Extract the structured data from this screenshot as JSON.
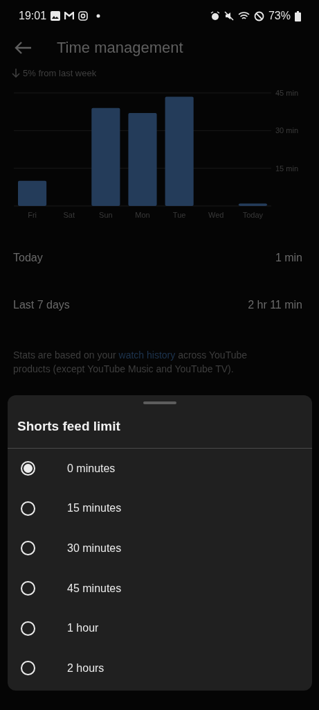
{
  "status_bar": {
    "time": "19:01",
    "battery": "73%"
  },
  "header": {
    "title": "Time management",
    "change": "5% from last week"
  },
  "chart_data": {
    "type": "bar",
    "categories": [
      "Fri",
      "Sat",
      "Sun",
      "Mon",
      "Tue",
      "Wed",
      "Today"
    ],
    "values": [
      10,
      0,
      39,
      37,
      43.5,
      0,
      1
    ],
    "ylim": [
      0,
      45
    ],
    "yticks": [
      {
        "value": 15,
        "label": "15 min"
      },
      {
        "value": 30,
        "label": "30 min"
      },
      {
        "value": 45,
        "label": "45 min"
      }
    ]
  },
  "stats": [
    {
      "label": "Today",
      "value": "1 min"
    },
    {
      "label": "Last 7 days",
      "value": "2 hr 11 min"
    }
  ],
  "footnote": {
    "before": "Stats are based on your ",
    "link": "watch history",
    "after": " across YouTube products (except YouTube Music and YouTube TV)."
  },
  "sheet": {
    "title": "Shorts feed limit",
    "options": [
      {
        "label": "0 minutes",
        "selected": true
      },
      {
        "label": "15 minutes",
        "selected": false
      },
      {
        "label": "30 minutes",
        "selected": false
      },
      {
        "label": "45 minutes",
        "selected": false
      },
      {
        "label": "1 hour",
        "selected": false
      },
      {
        "label": "2 hours",
        "selected": false
      }
    ]
  }
}
